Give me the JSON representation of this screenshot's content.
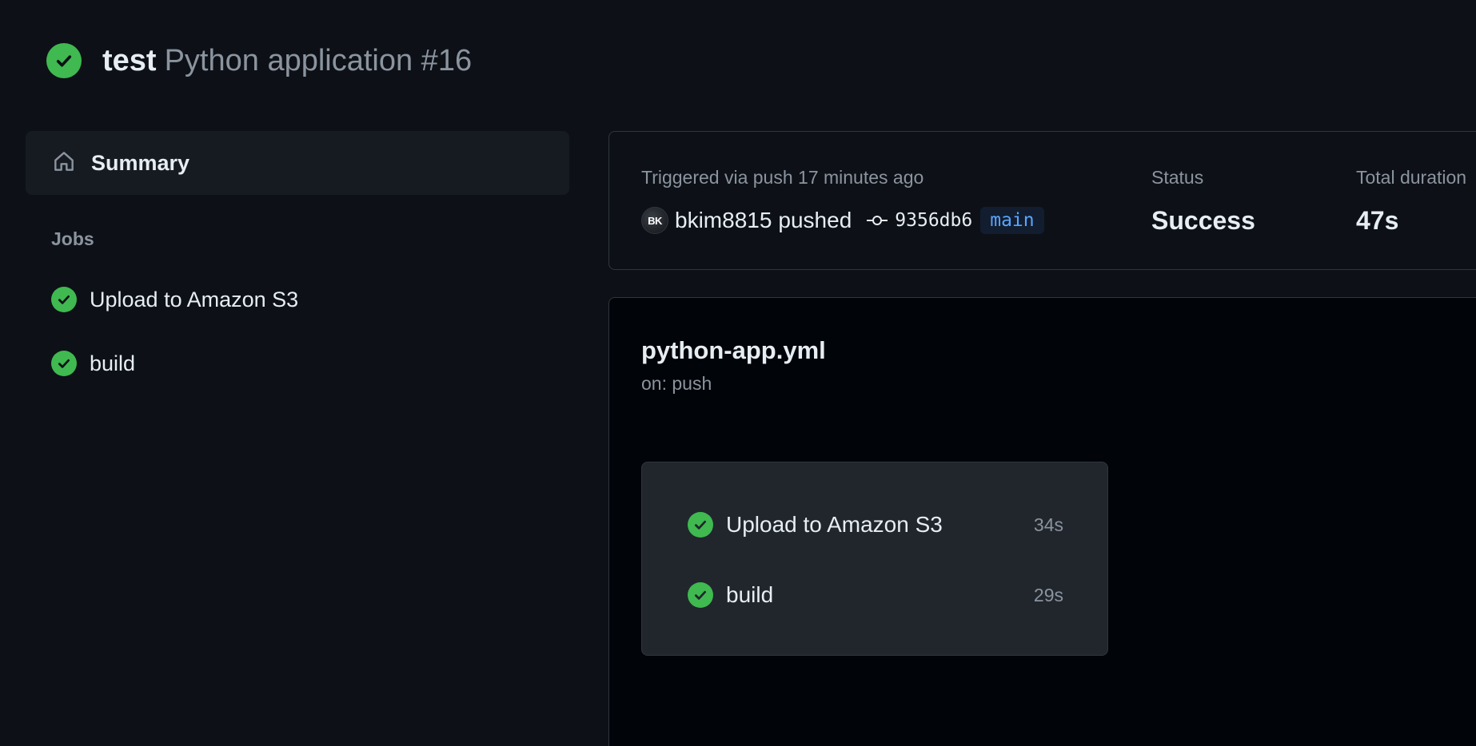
{
  "header": {
    "workflow_name": "test",
    "run_title": "Python application #16"
  },
  "sidebar": {
    "summary_label": "Summary",
    "jobs_heading": "Jobs",
    "jobs": [
      {
        "label": "Upload to Amazon S3",
        "status": "success"
      },
      {
        "label": "build",
        "status": "success"
      }
    ]
  },
  "summary": {
    "trigger_text": "Triggered via push 17 minutes ago",
    "avatar_initials": "BK",
    "username": "bkim8815",
    "action": "pushed",
    "commit_sha": "9356db6",
    "branch": "main",
    "status_label": "Status",
    "status_value": "Success",
    "duration_label": "Total duration",
    "duration_value": "47s"
  },
  "graph": {
    "file_name": "python-app.yml",
    "trigger": "on: push",
    "jobs": [
      {
        "label": "Upload to Amazon S3",
        "duration": "34s",
        "status": "success"
      },
      {
        "label": "build",
        "duration": "29s",
        "status": "success"
      }
    ]
  },
  "colors": {
    "background": "#0d1117",
    "success": "#3fb950",
    "link": "#58a6ff",
    "muted": "#8b949e",
    "border": "#30363d"
  },
  "icons": {
    "status": "check-circle-icon",
    "summary": "home-icon",
    "commit": "git-commit-icon"
  }
}
